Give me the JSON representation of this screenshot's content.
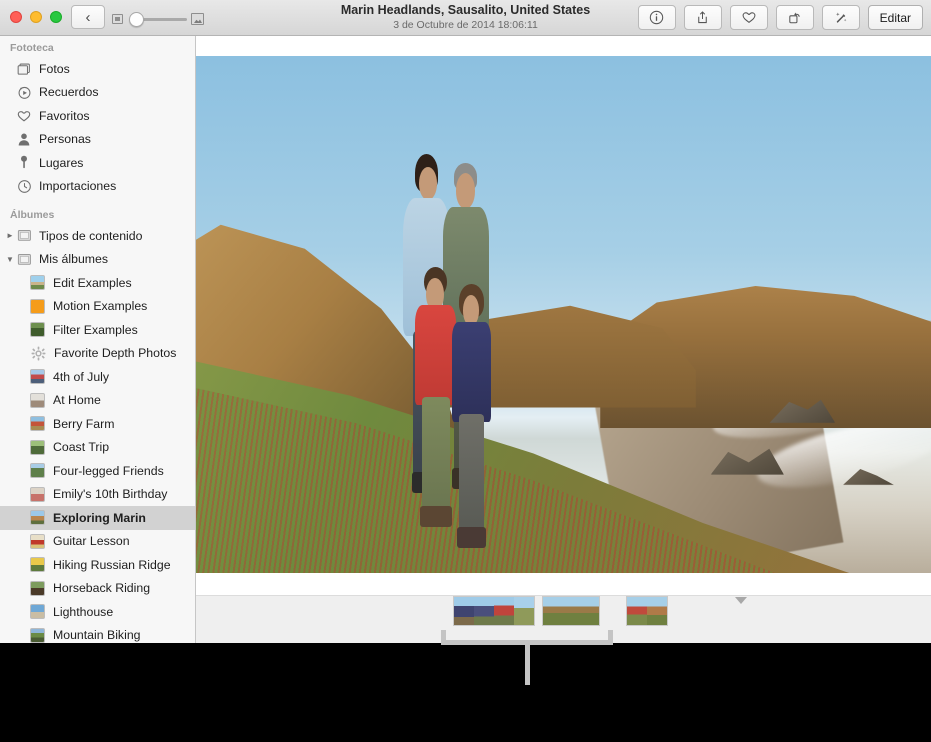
{
  "window": {
    "title": "Marin Headlands, Sausalito, United States",
    "subtitle": "3 de Octubre de 2014 18:06:11"
  },
  "toolbar": {
    "back_label": "‹",
    "zoom_slider": {
      "small_icon": "small-photo-icon",
      "large_icon": "large-photo-icon",
      "value": 10
    },
    "buttons": [
      {
        "name": "info-button",
        "icon": "info-icon"
      },
      {
        "name": "share-button",
        "icon": "share-icon"
      },
      {
        "name": "favorite-button",
        "icon": "heart-icon"
      },
      {
        "name": "rotate-button",
        "icon": "rotate-icon"
      },
      {
        "name": "enhance-button",
        "icon": "magic-wand-icon"
      }
    ],
    "edit_label": "Editar"
  },
  "sidebar": {
    "library_header": "Fototeca",
    "library_items": [
      {
        "label": "Fotos",
        "icon": "photos-icon"
      },
      {
        "label": "Recuerdos",
        "icon": "memories-icon"
      },
      {
        "label": "Favoritos",
        "icon": "heart-icon"
      },
      {
        "label": "Personas",
        "icon": "person-icon"
      },
      {
        "label": "Lugares",
        "icon": "pin-icon"
      },
      {
        "label": "Importaciones",
        "icon": "clock-icon"
      }
    ],
    "albums_header": "Álbumes",
    "groups": [
      {
        "label": "Tipos de contenido",
        "expanded": false,
        "icon": "folder-icon"
      },
      {
        "label": "Mis álbumes",
        "expanded": true,
        "icon": "folder-icon"
      }
    ],
    "albums": [
      {
        "label": "Edit Examples",
        "thumb": "t-edit",
        "selected": false
      },
      {
        "label": "Motion Examples",
        "thumb": "t-motion",
        "selected": false
      },
      {
        "label": "Filter Examples",
        "thumb": "t-filter",
        "selected": false
      },
      {
        "label": "Favorite Depth Photos",
        "thumb": "smart-gear",
        "selected": false
      },
      {
        "label": "4th of July",
        "thumb": "t-july",
        "selected": false
      },
      {
        "label": "At Home",
        "thumb": "t-home",
        "selected": false
      },
      {
        "label": "Berry Farm",
        "thumb": "t-berry",
        "selected": false
      },
      {
        "label": "Coast Trip",
        "thumb": "t-coast",
        "selected": false
      },
      {
        "label": "Four-legged Friends",
        "thumb": "t-four",
        "selected": false
      },
      {
        "label": "Emily's 10th Birthday",
        "thumb": "t-emily",
        "selected": false
      },
      {
        "label": "Exploring Marin",
        "thumb": "t-marin",
        "selected": true
      },
      {
        "label": "Guitar Lesson",
        "thumb": "t-guitar",
        "selected": false
      },
      {
        "label": "Hiking Russian Ridge",
        "thumb": "t-hiking",
        "selected": false
      },
      {
        "label": "Horseback Riding",
        "thumb": "t-horse",
        "selected": false
      },
      {
        "label": "Lighthouse",
        "thumb": "t-light",
        "selected": false
      },
      {
        "label": "Mountain Biking",
        "thumb": "t-mtn",
        "selected": false
      }
    ]
  },
  "viewer": {
    "photo_description": "Family of four standing on a coastal bluff above a beach at Marin Headlands"
  },
  "filmstrip": {
    "current_marker": "selected-photo-pointer",
    "groups": [
      {
        "name": "thumbnail-group-1",
        "thumbs": [
          "th-a",
          "th-b",
          "th-c",
          "th-d"
        ]
      },
      {
        "name": "thumbnail-group-2",
        "thumbs": [
          "th-wide"
        ]
      },
      {
        "name": "thumbnail-group-3",
        "thumbs": [
          "th-e",
          "th-f"
        ]
      }
    ]
  },
  "annotation": {
    "name": "callout-bracket"
  }
}
